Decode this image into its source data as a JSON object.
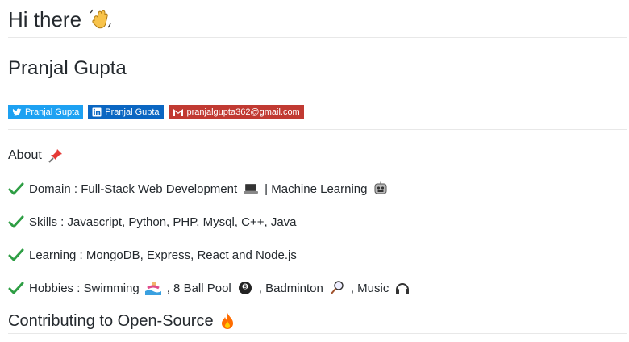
{
  "header": {
    "greeting": "Hi there"
  },
  "profile": {
    "name": "Pranjal Gupta"
  },
  "badges": {
    "twitter": "Pranjal Gupta",
    "linkedin": "Pranjal Gupta",
    "gmail": "pranjalgupta362@gmail.com"
  },
  "about": {
    "title": "About",
    "items": [
      {
        "text": "Domain : Full-Stack Web Development",
        "extra": "| Machine Learning"
      },
      {
        "text": "Skills : Javascript, Python, PHP, Mysql, C++, Java"
      },
      {
        "text": "Learning : MongoDB, Express, React and Node.js"
      },
      {
        "text": "Hobbies : Swimming",
        "p2": ", 8 Ball Pool",
        "p3": ", Badminton",
        "p4": ", Music"
      }
    ]
  },
  "contributing": {
    "title": "Contributing to Open-Source"
  },
  "colors": {
    "twitter": "#1da1f2",
    "linkedin": "#0a66c2",
    "gmail": "#c13a32",
    "check": "#2e9e44"
  },
  "icons": [
    "wave-icon",
    "twitter-icon",
    "linkedin-icon",
    "gmail-icon",
    "pushpin-icon",
    "check-icon",
    "laptop-icon",
    "robot-icon",
    "swimmer-icon",
    "8ball-icon",
    "badminton-icon",
    "headphones-icon",
    "fire-icon"
  ]
}
